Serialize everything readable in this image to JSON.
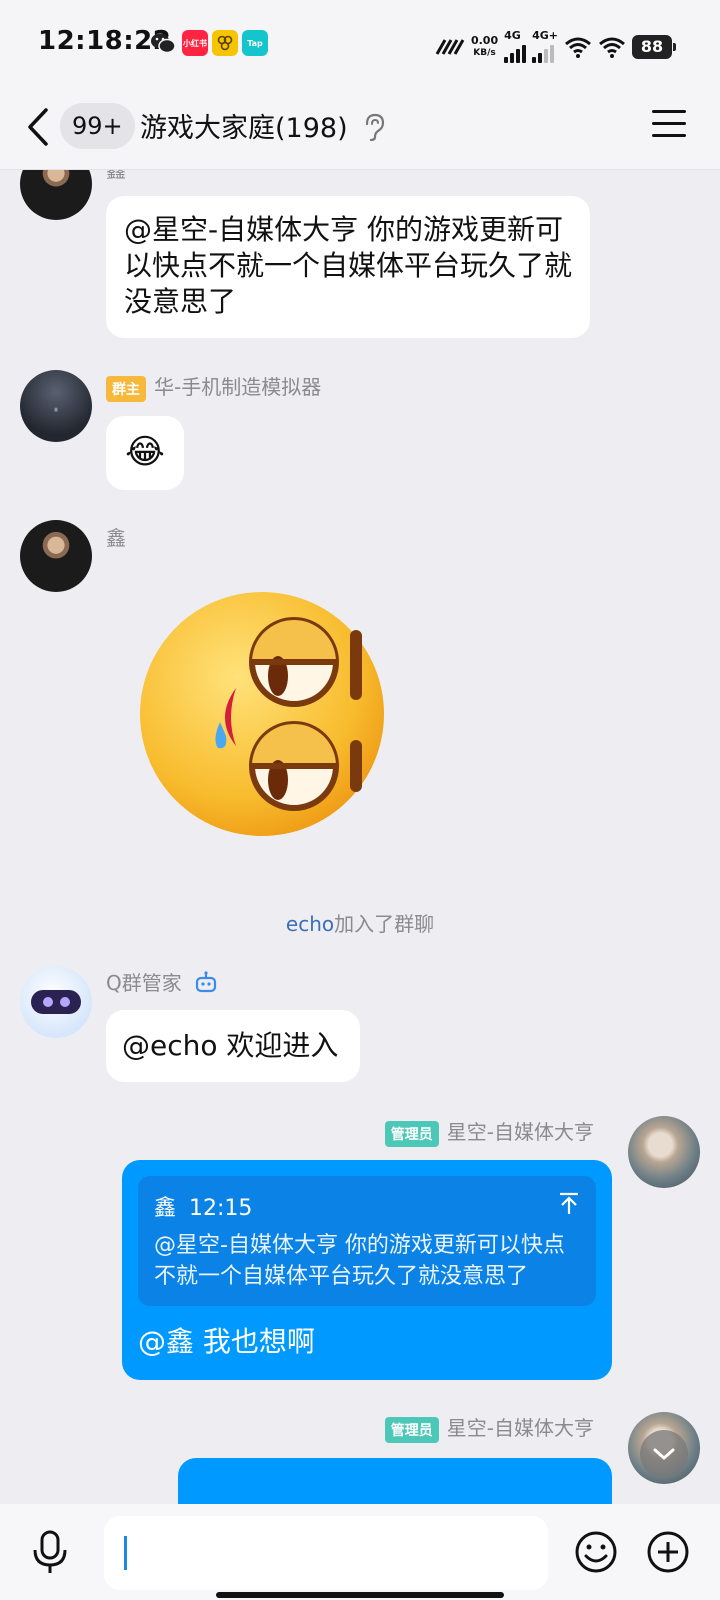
{
  "status_bar": {
    "time": "12:18:22",
    "apps": [
      "wechat-icon",
      "xiaohongshu-icon",
      "honey-icon",
      "taptap-icon"
    ],
    "xiaohongshu_label": "小红书",
    "tap_label": "Tap",
    "net_speed": "0.00",
    "net_unit": "KB/s",
    "sim1": "4G",
    "sim2": "4G+",
    "battery": "88"
  },
  "header": {
    "unread": "99+",
    "title": "游戏大家庭(198)"
  },
  "messages": [
    {
      "sender": "鑫",
      "text": "@星空-自媒体大亨 你的游戏更新可以快点不就一个自媒体平台玩久了就没意思了"
    },
    {
      "role": "群主",
      "sender": "华-手机制造模拟器",
      "emoji": "😂"
    },
    {
      "sender": "鑫",
      "sticker": "drooling-face-sticker"
    },
    {
      "system_name": "echo",
      "system_text": "加入了群聊"
    },
    {
      "sender": "Q群管家",
      "text": "@echo 欢迎进入"
    },
    {
      "role": "管理员",
      "sender": "星空-自媒体大亨",
      "quote_author": "鑫",
      "quote_time": "12:15",
      "quote_text": "@星空-自媒体大亨 你的游戏更新可以快点不就一个自媒体平台玩久了就没意思了",
      "reply": "@鑫 我也想啊"
    },
    {
      "role": "管理员",
      "sender": "星空-自媒体大亨"
    }
  ],
  "input": {
    "value": ""
  },
  "colors": {
    "accent": "#0099FF",
    "background": "#EEEEF2",
    "owner_tag": "#F6B93B",
    "admin_tag": "#4DC7B8"
  }
}
